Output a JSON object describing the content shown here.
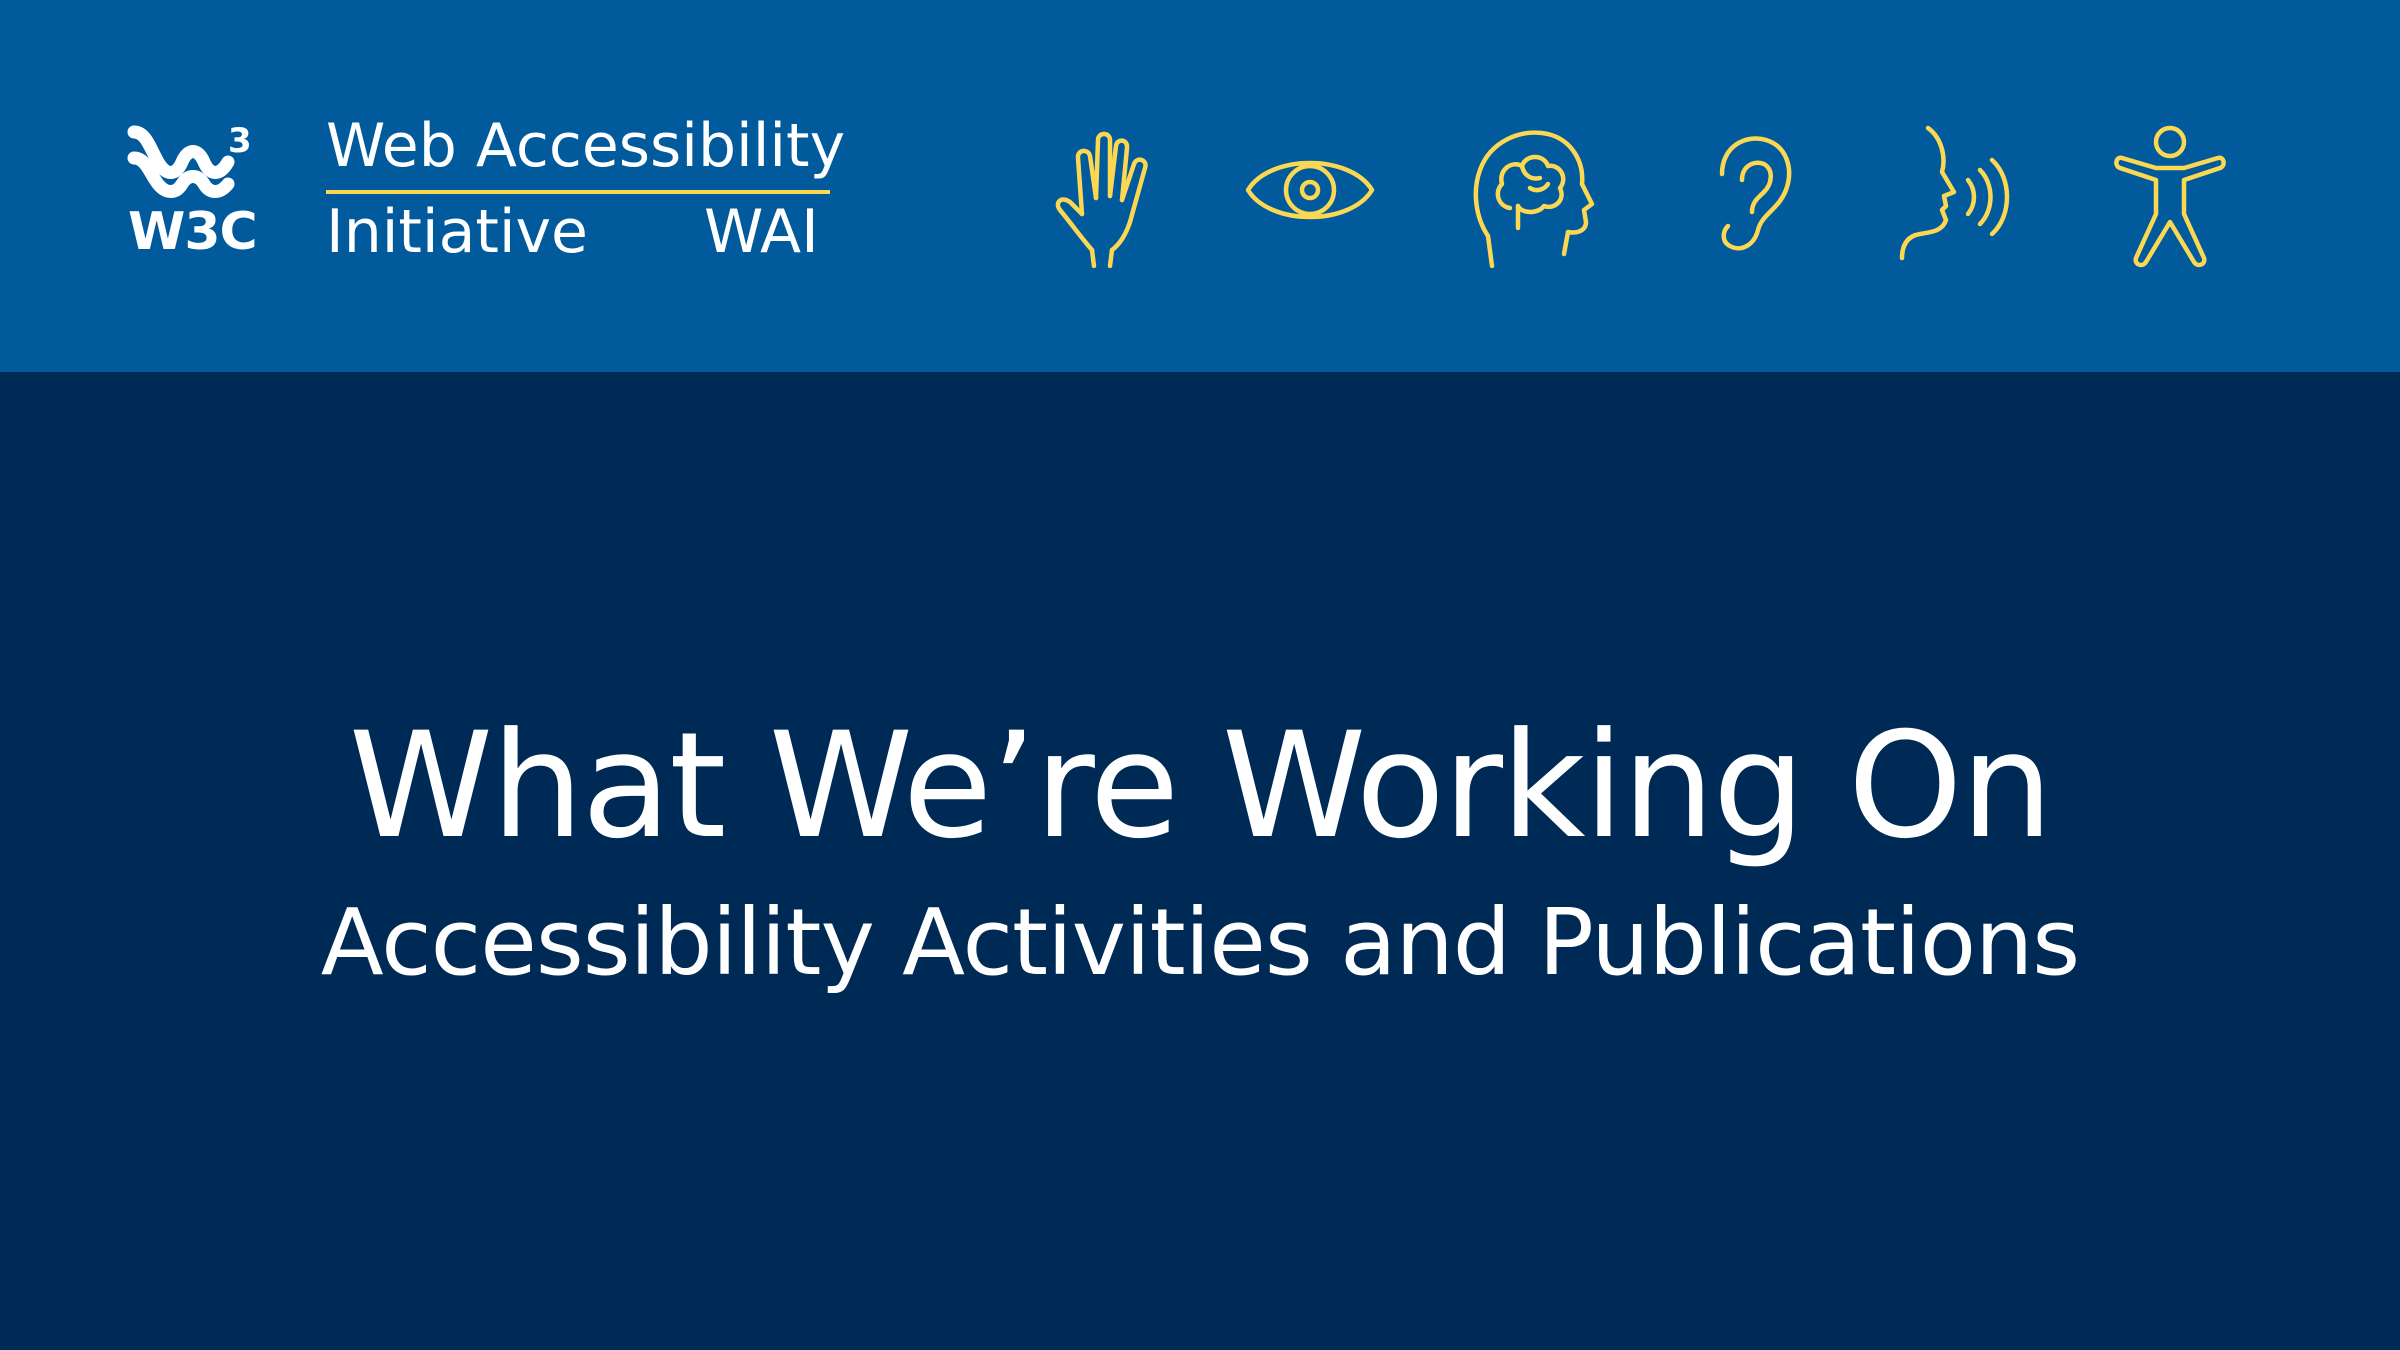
{
  "colors": {
    "header_background": "#005a9c",
    "body_background": "#002a56",
    "accent_yellow": "#fcd852",
    "text": "#ffffff"
  },
  "logo": {
    "icon": "w3c-logo-icon",
    "wordmark": "W3C"
  },
  "wai": {
    "line1": "Web Accessibility",
    "line2": "Initiative",
    "acronym": "WAI"
  },
  "disability_icons": [
    "hand-icon",
    "eye-icon",
    "brain-head-icon",
    "ear-icon",
    "speech-icon",
    "accessibility-figure-icon"
  ],
  "main": {
    "title": "What We’re Working On",
    "subtitle": "Accessibility Activities and Publications"
  }
}
